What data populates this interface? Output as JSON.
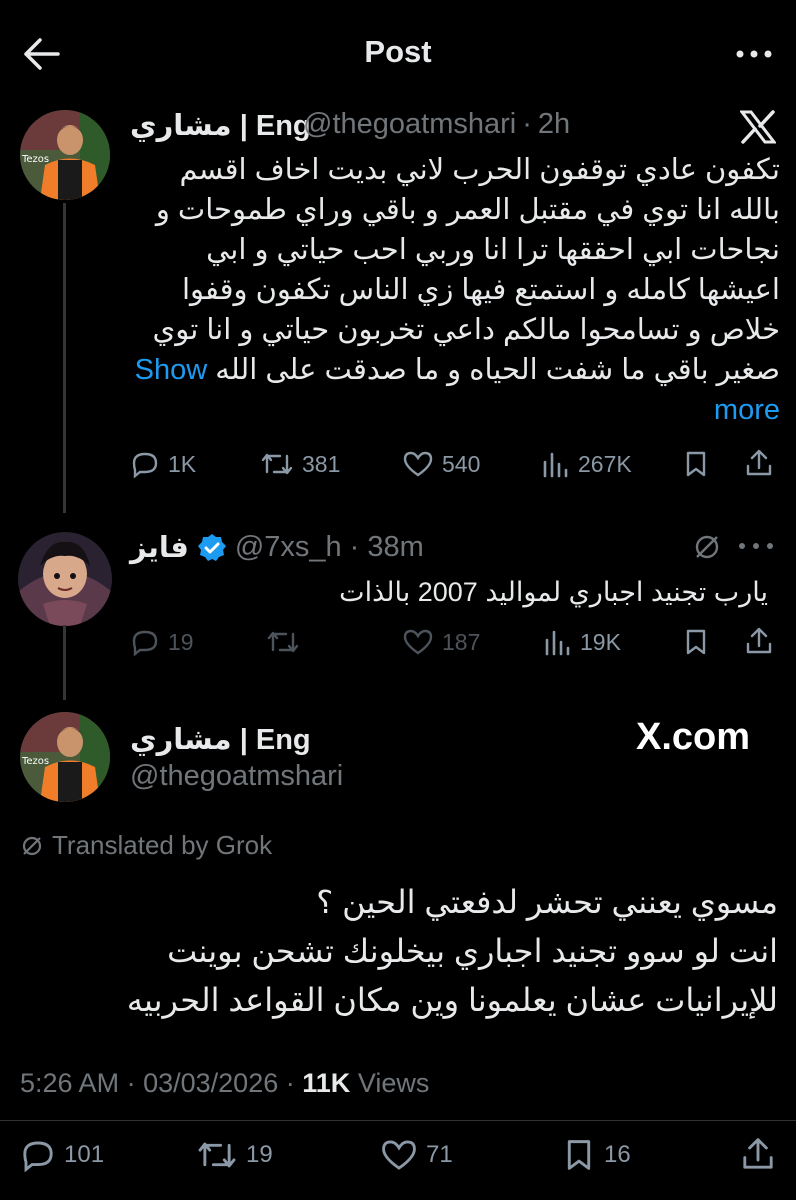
{
  "header": {
    "title": "Post"
  },
  "tweet1": {
    "name": "مشاري | Eng",
    "handle": "@thegoatmshari",
    "sep": "·",
    "time": "2h",
    "text": "تكفون عادي توقفون الحرب لاني بديت اخاف اقسم بالله انا توي في مقتبل العمر و باقي وراي طموحات و نجاحات ابي احققها ترا انا وربي احب حياتي و ابي اعيشها كامله و استمتع فيها زي الناس تكفون وقفوا خلاص و تسامحوا مالكم داعي تخربون حياتي و انا توي صغير باقي ما شفت الحياه و ما صدقت على الله",
    "show_more": "Show more",
    "actions": {
      "replies": "1K",
      "reposts": "381",
      "likes": "540",
      "views": "267K"
    }
  },
  "tweet2": {
    "name": "فايز",
    "handle": "@7xs_h",
    "sep": "·",
    "time": "38m",
    "text": "يارب تجنيد اجباري لمواليد 2007 بالذات",
    "actions": {
      "replies": "19",
      "likes": "187",
      "views": "19K"
    }
  },
  "tweet3": {
    "name": "مشاري | Eng",
    "handle": "@thegoatmshari",
    "brand": "X.com",
    "translated": "Translated by Grok",
    "text_lines": [
      "مسوي يعنني تحشر لدفعتي الحين ؟",
      "انت لو سوو تجنيد اجباري بيخلونك تشحن بوينت",
      "للإيرانيات عشان يعلمونا وين مكان القواعد الحربيه"
    ],
    "time": "5:26 AM",
    "sep": "·",
    "date": "03/03/2026",
    "views_count": "11K",
    "views_label": "Views",
    "actions": {
      "replies": "101",
      "reposts": "19",
      "likes": "71",
      "bookmarks": "16"
    }
  },
  "colors": {
    "background": "#000000",
    "text": "#e7e9ea",
    "muted": "#71767b",
    "link": "#1d9bf0",
    "verified": "#1d9bf0"
  }
}
